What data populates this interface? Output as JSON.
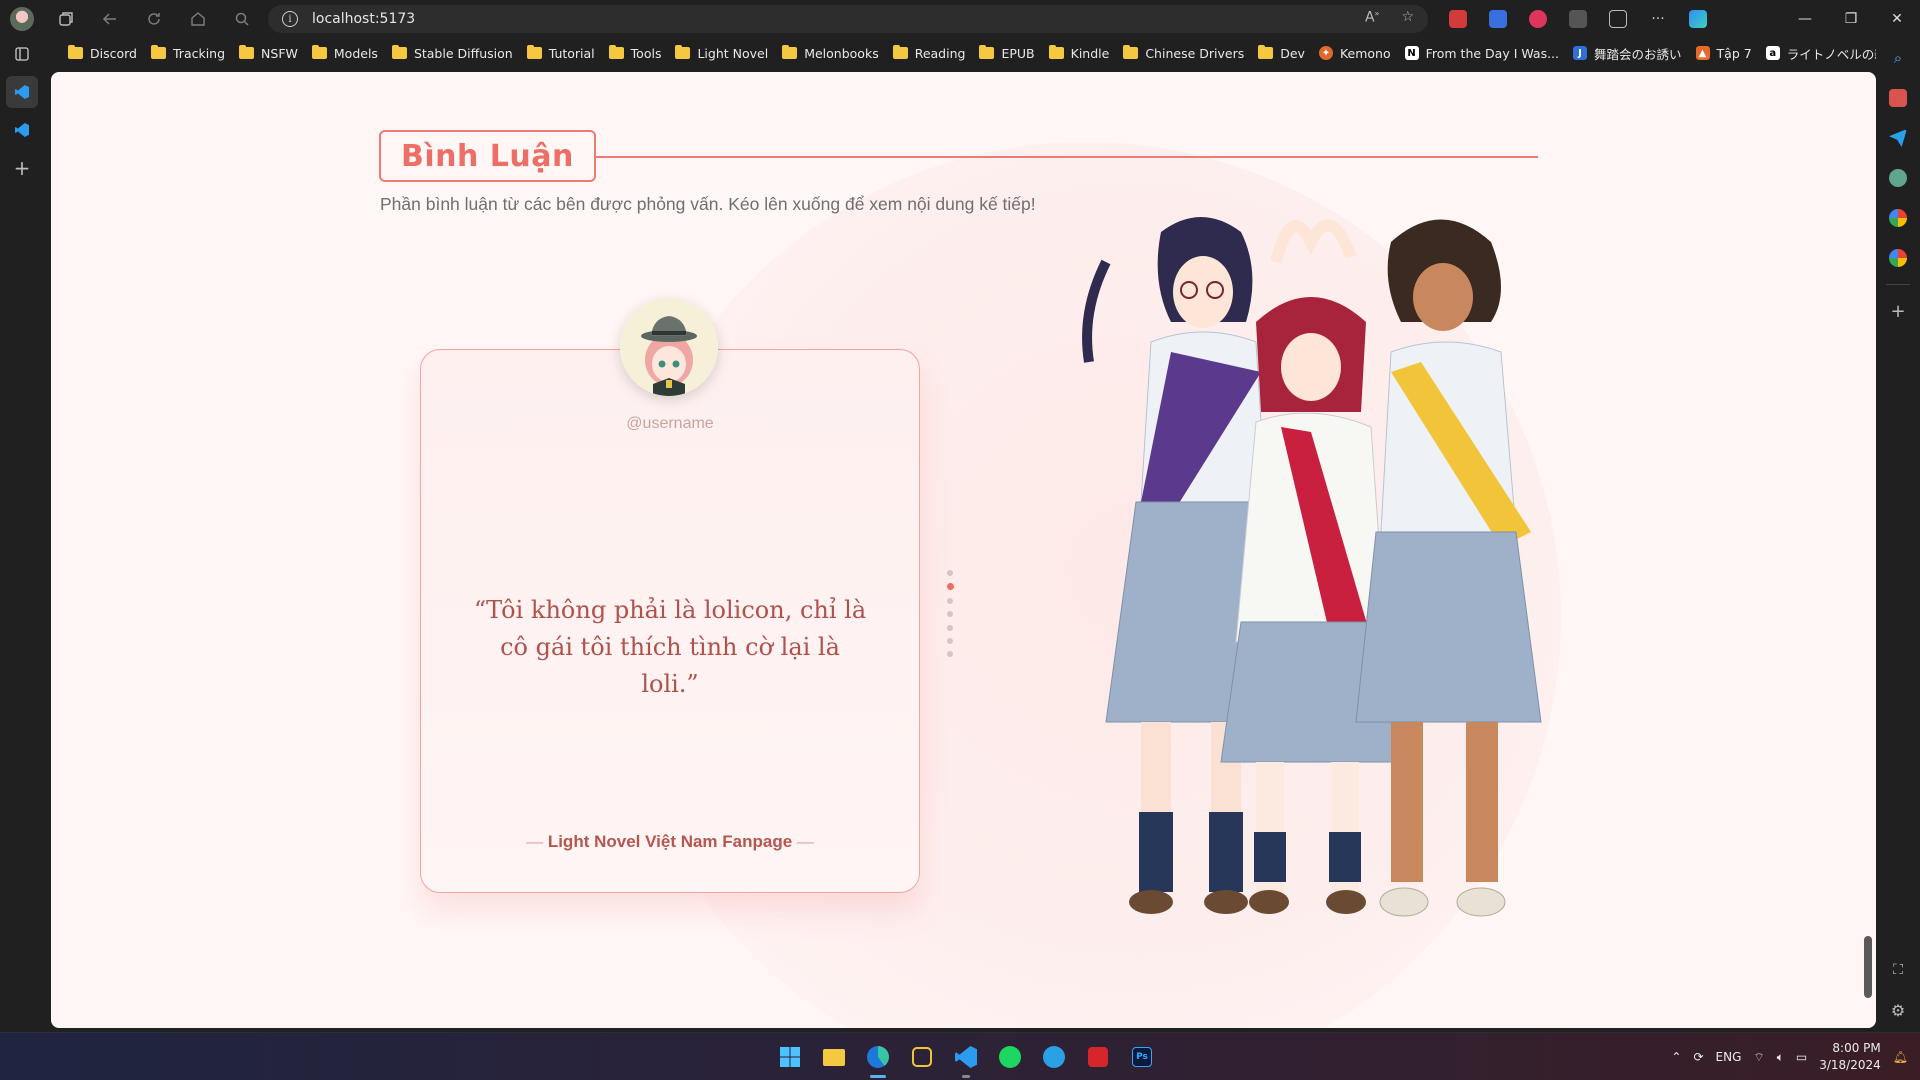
{
  "browser": {
    "url": "localhost:5173",
    "bookmarks": [
      {
        "label": "Discord",
        "icon": "folder"
      },
      {
        "label": "Tracking",
        "icon": "folder"
      },
      {
        "label": "NSFW",
        "icon": "folder"
      },
      {
        "label": "Models",
        "icon": "folder"
      },
      {
        "label": "Stable Diffusion",
        "icon": "folder"
      },
      {
        "label": "Tutorial",
        "icon": "folder"
      },
      {
        "label": "Tools",
        "icon": "folder"
      },
      {
        "label": "Light Novel",
        "icon": "folder"
      },
      {
        "label": "Melonbooks",
        "icon": "folder"
      },
      {
        "label": "Reading",
        "icon": "folder"
      },
      {
        "label": "EPUB",
        "icon": "folder"
      },
      {
        "label": "Kindle",
        "icon": "folder"
      },
      {
        "label": "Chinese Drivers",
        "icon": "folder"
      },
      {
        "label": "Dev",
        "icon": "folder"
      },
      {
        "label": "Kemono",
        "icon": "kemono-icon"
      },
      {
        "label": "From the Day I Was...",
        "icon": "notion-icon"
      },
      {
        "label": "舞踏会のお誘い",
        "icon": "blue-j-icon"
      },
      {
        "label": "Tập 7",
        "icon": "flame-icon"
      },
      {
        "label": "ライトノベルの新潮流",
        "icon": "amazon-icon"
      }
    ]
  },
  "page": {
    "heading": "Bình Luận",
    "subtitle": "Phần bình luận từ các bên được phỏng vấn. Kéo lên xuống để xem nội dung kế tiếp!",
    "card": {
      "username": "@username",
      "quote": "“Tôi không phải là lolicon, chỉ là cô gái tôi thích tình cờ lại là loli.”",
      "author": "Light Novel Việt Nam Fanpage",
      "dash": "—"
    },
    "carousel": {
      "count": 7,
      "active_index": 1
    },
    "accent_color": "#ec6e65"
  },
  "taskbar": {
    "lang": "ENG",
    "time": "8:00 PM",
    "date": "3/18/2024"
  }
}
